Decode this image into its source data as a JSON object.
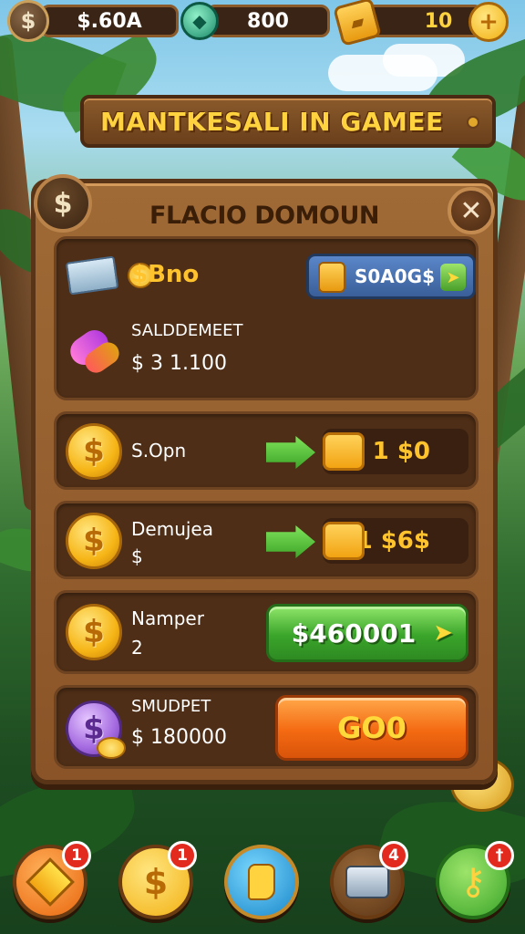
{
  "hud": {
    "cash_value": "$.60A",
    "gems_value": "800",
    "tickets_value": "10"
  },
  "banner": {
    "title": "MANTKESALI IN GAMEE"
  },
  "panel": {
    "title": "FLACIO DOMOUN",
    "close_glyph": "✕",
    "coin_glyph": "$"
  },
  "rows": [
    {
      "top_label": "$Bno",
      "balance_button": "S0A0G$",
      "section_label": "SALDDEMEET",
      "section_value": "$ 3  1.100"
    },
    {
      "name": "S.Opn",
      "sub": "",
      "price": "1 $0"
    },
    {
      "name": "Demujea",
      "sub": "$",
      "price": "1 $6$"
    },
    {
      "name": "Namper",
      "sub": "2",
      "button": "$460001"
    },
    {
      "name": "SMUDPET",
      "sub": "$ 180000",
      "button": "GO0"
    }
  ],
  "nav": {
    "badges": [
      "1",
      "1",
      "",
      "4",
      "†"
    ]
  },
  "colors": {
    "gold": "#ffd23f",
    "wood": "#8a5428",
    "green": "#3aa52a",
    "orange": "#f46a12"
  }
}
